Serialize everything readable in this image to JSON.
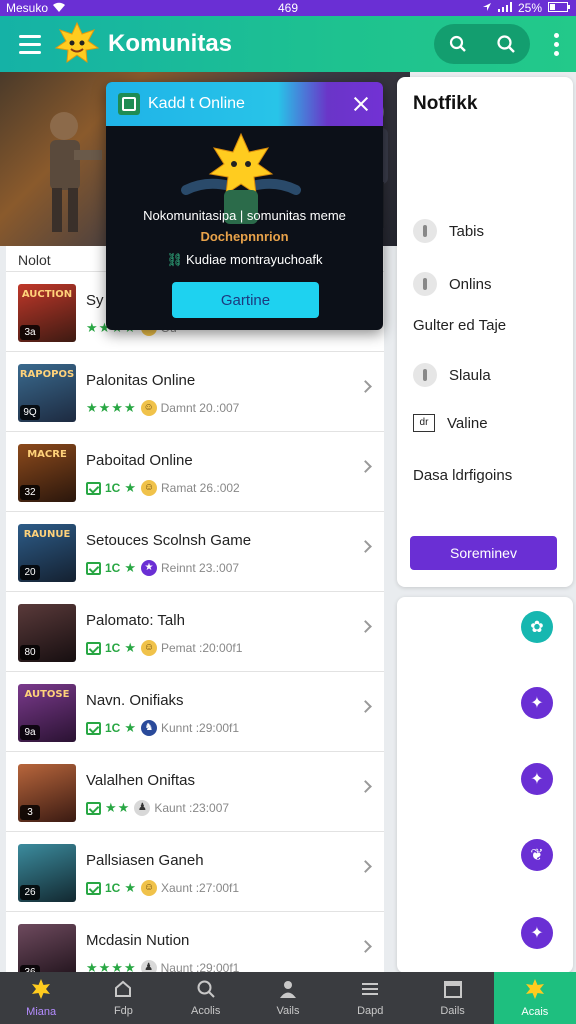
{
  "status_bar": {
    "carrier": "Mesuko",
    "time": "469",
    "battery": "25%"
  },
  "app_bar": {
    "title": "Komunitas"
  },
  "list": {
    "header": "Nolot",
    "rows": [
      {
        "title": "Sy",
        "meta": "Ou",
        "thumb_text": "AUCTION",
        "badge": "3a",
        "colors": [
          "#c0382a",
          "#3d1a12"
        ]
      },
      {
        "title": "Palonitas Online",
        "meta": "Damnt 20.:007",
        "thumb_text": "RAPOPOS",
        "badge": "9Q",
        "colors": [
          "#3a6a8e",
          "#1d2a40"
        ]
      },
      {
        "title": "Paboitad Online",
        "meta": "Ramat 26.:002",
        "thumb_text": "MACRE",
        "badge": "32",
        "colors": [
          "#8c4a1c",
          "#2a160c"
        ]
      },
      {
        "title": "Setouces Scolnsh Game",
        "meta": "Reinnt 23.:007",
        "thumb_text": "RAUNUE",
        "badge": "20",
        "colors": [
          "#2d5c88",
          "#142030"
        ]
      },
      {
        "title": "Palomato: Talh",
        "meta": "Pemat :20:00f1",
        "thumb_text": "",
        "badge": "80",
        "colors": [
          "#5a3a3a",
          "#160e10"
        ]
      },
      {
        "title": "Navn. Onifiaks",
        "meta": "Kunnt :29:00f1",
        "thumb_text": "AUTOSE",
        "badge": "9a",
        "colors": [
          "#7a3a8c",
          "#2a1232"
        ]
      },
      {
        "title": "Valalhen Oniftas",
        "meta": "Kaunt :23:007",
        "thumb_text": "",
        "badge": "3",
        "colors": [
          "#b8663c",
          "#3a1a12"
        ]
      },
      {
        "title": "Pallsiasen Ganeh",
        "meta": "Xaunt :27:00f1",
        "thumb_text": "",
        "badge": "26",
        "colors": [
          "#3c8c9e",
          "#122830"
        ]
      },
      {
        "title": "Mcdasin Nution",
        "meta": "Naunt :29:00f1",
        "thumb_text": "",
        "badge": "36",
        "colors": [
          "#6e4a5e",
          "#1c1018"
        ]
      }
    ],
    "ratings": [
      "",
      "",
      "1C",
      "1C",
      "1C",
      "1C",
      "",
      "1C",
      ""
    ]
  },
  "modal": {
    "title": "Kadd t Online",
    "line1": "Nokomunitasipa | somunitas meme",
    "line2": "Dochepnnrion",
    "line3": "Kudiae montrayuchoafk",
    "button": "Gartine"
  },
  "notif": {
    "title": "Notfikk",
    "items": [
      "Tabis",
      "Onlins",
      "Gulter ed Taje",
      "Slaula",
      "Valine",
      "Dasa ldrfigoins"
    ],
    "box_label": "dr",
    "button": "Soreminev"
  },
  "side_icons": [
    {
      "color": "#17b7b0",
      "glyph": "✿"
    },
    {
      "color": "#6a2fd4",
      "glyph": "✦"
    },
    {
      "color": "#6a2fd4",
      "glyph": "✦"
    },
    {
      "color": "#6a2fd4",
      "glyph": "❦"
    },
    {
      "color": "#6a2fd4",
      "glyph": "✦"
    }
  ],
  "bottom_nav": [
    {
      "label": "Miana",
      "icon": "mascot-icon"
    },
    {
      "label": "Fdp",
      "icon": "home-icon"
    },
    {
      "label": "Acolis",
      "icon": "search-icon"
    },
    {
      "label": "Vails",
      "icon": "person-icon"
    },
    {
      "label": "Dapd",
      "icon": "menu-icon"
    },
    {
      "label": "Dails",
      "icon": "calendar-icon"
    },
    {
      "label": "Acais",
      "icon": "mascot-icon"
    }
  ],
  "colors": {
    "accent": "#1ebf7f",
    "brand_purple": "#6a2fd4",
    "rating_green": "#29a744"
  }
}
